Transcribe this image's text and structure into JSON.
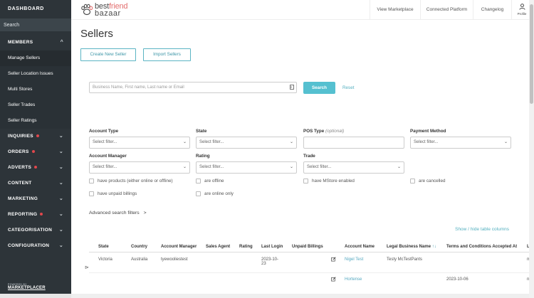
{
  "sidebar": {
    "title": "DASHBOARD",
    "search_label": "Search",
    "members": {
      "label": "MEMBERS",
      "chevron": "^"
    },
    "member_items": [
      {
        "label": "Manage Sellers"
      },
      {
        "label": "Seller Location Issues"
      },
      {
        "label": "Multi Stores"
      },
      {
        "label": "Seller Trades"
      },
      {
        "label": "Seller Ratings"
      }
    ],
    "sections": [
      {
        "label": "INQUIRIES",
        "badge": true
      },
      {
        "label": "ORDERS",
        "badge": true
      },
      {
        "label": "ADVERTS",
        "badge": true
      },
      {
        "label": "CONTENT",
        "badge": false
      },
      {
        "label": "MARKETING",
        "badge": false
      },
      {
        "label": "REPORTING",
        "badge": true
      },
      {
        "label": "CATEGORISATION",
        "badge": false
      },
      {
        "label": "CONFIGURATION",
        "badge": false
      }
    ],
    "footer_powered": "POWERED BY",
    "footer_brand": "MARKETPLACER"
  },
  "topbar": {
    "logo_line1_a": "best",
    "logo_line1_b": "friend",
    "logo_line2": "bazaar",
    "nav": [
      {
        "label": "View Marketplace"
      },
      {
        "label": "Connected Platform"
      },
      {
        "label": "Changelog"
      }
    ],
    "profile_label": "Profile"
  },
  "page": {
    "title": "Sellers",
    "create_button": "Create New Seller",
    "import_button": "Import Sellers"
  },
  "search": {
    "placeholder": "Business Name, First name, Last name or Email",
    "button": "Search",
    "reset": "Reset"
  },
  "filters": {
    "account_type": {
      "label": "Account Type",
      "value": "Select filter..."
    },
    "state": {
      "label": "State",
      "value": "Select filter..."
    },
    "pos_type": {
      "label": "POS Type",
      "optional": "(optional)",
      "value": ""
    },
    "payment_method": {
      "label": "Payment Method",
      "value": "Select filter..."
    },
    "account_manager": {
      "label": "Account Manager",
      "value": "Select filter..."
    },
    "rating": {
      "label": "Rating",
      "value": "Select filter..."
    },
    "trade": {
      "label": "Trade",
      "value": "Select filter..."
    },
    "checkboxes": [
      {
        "label": "have products (either online or offline)"
      },
      {
        "label": "are offline"
      },
      {
        "label": "have MStore enabled"
      },
      {
        "label": "are cancelled"
      },
      {
        "label": "have unpaid billings"
      },
      {
        "label": "are online only"
      }
    ],
    "advanced": "Advanced search filters",
    "advanced_arrow": ">"
  },
  "table": {
    "show_hide": "Show / hide table columns",
    "columns": {
      "state": "State",
      "country": "Country",
      "account_manager": "Account Manager",
      "sales_agent": "Sales Agent",
      "rating": "Rating",
      "last_login": "Last Login",
      "unpaid_billings": "Unpaid Billings",
      "account_name": "Account Name",
      "legal_business_name": "Legal Business Name",
      "legal_sort": "↑↓",
      "terms": "Terms and Conditions Accepted At",
      "overflow": "L"
    },
    "rows": [
      {
        "state": "Victoria",
        "country": "Australia",
        "account_manager": "tyewooliestest",
        "last_login_line1": "2023-10-",
        "last_login_line2": "23",
        "account_name": "Nigel Test",
        "legal_business_name": "Testy McTestPants",
        "terms": "",
        "overflow": "m"
      },
      {
        "state": "",
        "country": "",
        "account_manager": "",
        "last_login_line1": "",
        "last_login_line2": "",
        "account_name": "Hortense",
        "legal_business_name": "",
        "terms": "2023-10-06",
        "overflow": "n"
      }
    ],
    "row_handle": "⊳"
  },
  "colors": {
    "sidebar_bg": "#2d3439",
    "accent": "#55c0d0",
    "badge": "#e0474c",
    "logo_pink": "#e36f6f"
  }
}
